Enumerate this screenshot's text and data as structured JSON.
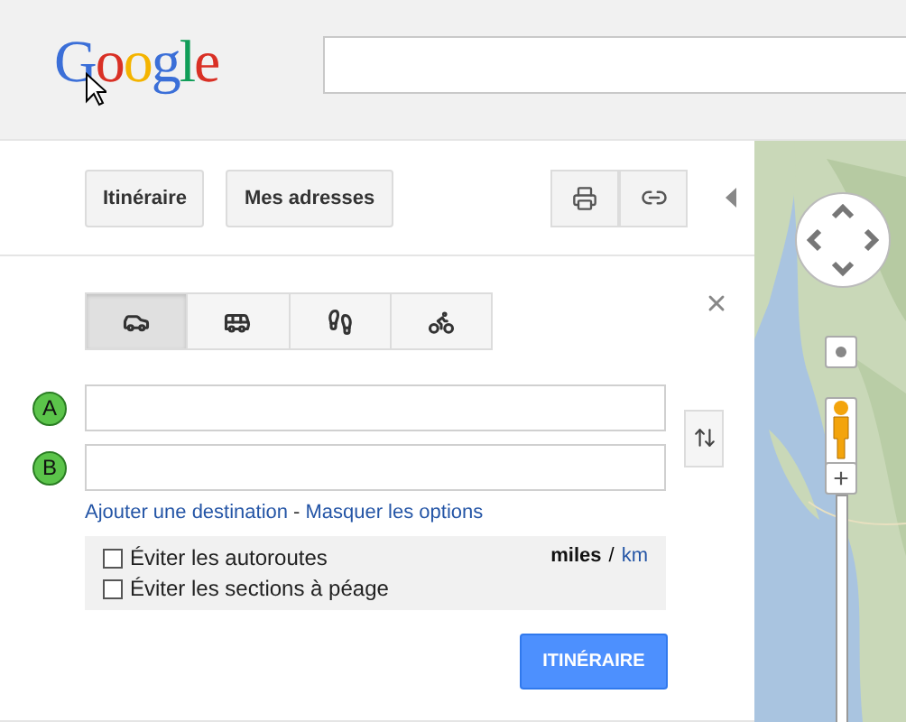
{
  "header": {
    "logo": "Google"
  },
  "toolbar": {
    "buttons": [
      {
        "label": "Itinéraire"
      },
      {
        "label": "Mes adresses"
      }
    ],
    "icon_buttons": [
      {
        "kind": "print"
      },
      {
        "kind": "link"
      }
    ]
  },
  "directions": {
    "modes": [
      {
        "kind": "car",
        "selected": true
      },
      {
        "kind": "transit",
        "selected": false
      },
      {
        "kind": "walk",
        "selected": false
      },
      {
        "kind": "bike",
        "selected": false
      }
    ],
    "waypoints": [
      {
        "marker": "A"
      },
      {
        "marker": "B"
      }
    ],
    "links": [
      "Ajouter une destination",
      "Masquer les options"
    ],
    "link_separator": "-",
    "options": [
      {
        "label": "Éviter les autoroutes",
        "checked": false
      },
      {
        "label": "Éviter les sections à péage",
        "checked": false
      }
    ],
    "units": [
      {
        "label": "miles",
        "selected": true
      },
      {
        "label": "km",
        "selected": false
      }
    ],
    "unit_separator": "/",
    "submit": "ITINÉRAIRE"
  },
  "map": {
    "zoom_in": "+"
  }
}
